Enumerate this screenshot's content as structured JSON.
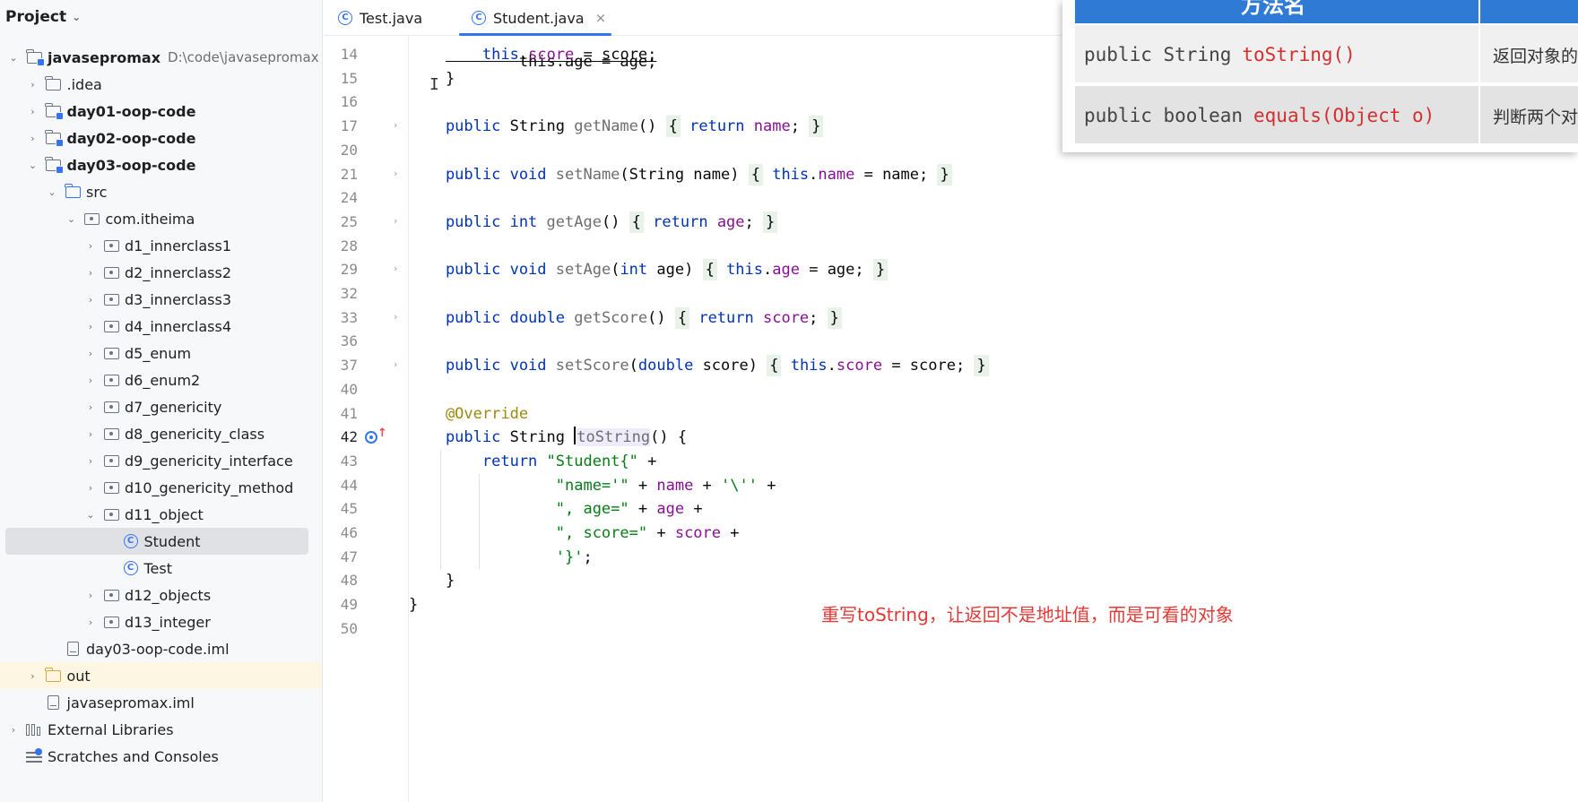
{
  "sidebar": {
    "title": "Project",
    "items": [
      {
        "label": "javasepromax",
        "path": "D:\\code\\javasepromax",
        "indent": 0,
        "arrow": "down",
        "icon": "module",
        "bold": true
      },
      {
        "label": ".idea",
        "indent": 1,
        "arrow": "right",
        "icon": "folder"
      },
      {
        "label": "day01-oop-code",
        "indent": 1,
        "arrow": "right",
        "icon": "module",
        "bold": true
      },
      {
        "label": "day02-oop-code",
        "indent": 1,
        "arrow": "right",
        "icon": "module",
        "bold": true
      },
      {
        "label": "day03-oop-code",
        "indent": 1,
        "arrow": "down",
        "icon": "module",
        "bold": true
      },
      {
        "label": "src",
        "indent": 2,
        "arrow": "down",
        "icon": "src"
      },
      {
        "label": "com.itheima",
        "indent": 3,
        "arrow": "down",
        "icon": "package"
      },
      {
        "label": "d1_innerclass1",
        "indent": 4,
        "arrow": "right",
        "icon": "package"
      },
      {
        "label": "d2_innerclass2",
        "indent": 4,
        "arrow": "right",
        "icon": "package"
      },
      {
        "label": "d3_innerclass3",
        "indent": 4,
        "arrow": "right",
        "icon": "package"
      },
      {
        "label": "d4_innerclass4",
        "indent": 4,
        "arrow": "right",
        "icon": "package"
      },
      {
        "label": "d5_enum",
        "indent": 4,
        "arrow": "right",
        "icon": "package"
      },
      {
        "label": "d6_enum2",
        "indent": 4,
        "arrow": "right",
        "icon": "package"
      },
      {
        "label": "d7_genericity",
        "indent": 4,
        "arrow": "right",
        "icon": "package"
      },
      {
        "label": "d8_genericity_class",
        "indent": 4,
        "arrow": "right",
        "icon": "package"
      },
      {
        "label": "d9_genericity_interface",
        "indent": 4,
        "arrow": "right",
        "icon": "package"
      },
      {
        "label": "d10_genericity_method",
        "indent": 4,
        "arrow": "right",
        "icon": "package"
      },
      {
        "label": "d11_object",
        "indent": 4,
        "arrow": "down",
        "icon": "package"
      },
      {
        "label": "Student",
        "indent": 5,
        "arrow": "",
        "icon": "class",
        "selected": true
      },
      {
        "label": "Test",
        "indent": 5,
        "arrow": "",
        "icon": "class"
      },
      {
        "label": "d12_objects",
        "indent": 4,
        "arrow": "right",
        "icon": "package"
      },
      {
        "label": "d13_integer",
        "indent": 4,
        "arrow": "right",
        "icon": "package"
      },
      {
        "label": "day03-oop-code.iml",
        "indent": 2,
        "arrow": "",
        "icon": "file"
      },
      {
        "label": "out",
        "indent": 1,
        "arrow": "right",
        "icon": "folder-orange",
        "highlight": true
      },
      {
        "label": "javasepromax.iml",
        "indent": 1,
        "arrow": "",
        "icon": "file"
      },
      {
        "label": "External Libraries",
        "indent": 0,
        "arrow": "right",
        "icon": "library"
      },
      {
        "label": "Scratches and Consoles",
        "indent": 0,
        "arrow": "",
        "icon": "scratches"
      }
    ]
  },
  "tabs": [
    {
      "label": "Test.java",
      "active": false
    },
    {
      "label": "Student.java",
      "active": true,
      "close": "×"
    }
  ],
  "editor": {
    "line_numbers": [
      "14",
      "15",
      "16",
      "17",
      "20",
      "21",
      "24",
      "25",
      "28",
      "29",
      "32",
      "33",
      "36",
      "37",
      "40",
      "41",
      "42",
      "43",
      "44",
      "45",
      "46",
      "47",
      "48",
      "49",
      "50"
    ],
    "current_line": "42",
    "lines": [
      {
        "n": "14",
        "segs": [
          [
            "",
            "        "
          ],
          [
            "kw",
            "this"
          ],
          [
            "",
            ".",
            ""
          ],
          [
            "fld",
            "score"
          ],
          [
            "",
            " = score;"
          ]
        ]
      },
      {
        "n": "15",
        "segs": [
          [
            "",
            "    }"
          ]
        ]
      },
      {
        "n": "16",
        "segs": []
      },
      {
        "n": "17",
        "segs": [
          [
            "kw",
            "    public "
          ],
          [
            "",
            "String "
          ],
          [
            "fn",
            "getName"
          ],
          [
            "",
            "() "
          ],
          [
            "brc",
            "{"
          ],
          [
            "kw",
            " return "
          ],
          [
            "fld",
            "name"
          ],
          [
            "",
            "; "
          ],
          [
            "brc",
            "}"
          ]
        ]
      },
      {
        "n": "20",
        "segs": []
      },
      {
        "n": "21",
        "segs": [
          [
            "kw",
            "    public void "
          ],
          [
            "fn",
            "setName"
          ],
          [
            "",
            "(String name) "
          ],
          [
            "brc",
            "{"
          ],
          [
            "kw",
            " this"
          ],
          [
            "",
            "."
          ],
          [
            "fld",
            "name"
          ],
          [
            "",
            " = name; "
          ],
          [
            "brc",
            "}"
          ]
        ]
      },
      {
        "n": "24",
        "segs": []
      },
      {
        "n": "25",
        "segs": [
          [
            "kw",
            "    public int "
          ],
          [
            "fn",
            "getAge"
          ],
          [
            "",
            "() "
          ],
          [
            "brc",
            "{"
          ],
          [
            "kw",
            " return "
          ],
          [
            "fld",
            "age"
          ],
          [
            "",
            "; "
          ],
          [
            "brc",
            "}"
          ]
        ]
      },
      {
        "n": "28",
        "segs": []
      },
      {
        "n": "29",
        "segs": [
          [
            "kw",
            "    public void "
          ],
          [
            "fn",
            "setAge"
          ],
          [
            "",
            "("
          ],
          [
            "kw",
            "int"
          ],
          [
            "",
            " age) "
          ],
          [
            "brc",
            "{"
          ],
          [
            "kw",
            " this"
          ],
          [
            "",
            "."
          ],
          [
            "fld",
            "age"
          ],
          [
            "",
            " = age; "
          ],
          [
            "brc",
            "}"
          ]
        ]
      },
      {
        "n": "32",
        "segs": []
      },
      {
        "n": "33",
        "segs": [
          [
            "kw",
            "    public double "
          ],
          [
            "fn",
            "getScore"
          ],
          [
            "",
            "() "
          ],
          [
            "brc",
            "{"
          ],
          [
            "kw",
            " return "
          ],
          [
            "fld",
            "score"
          ],
          [
            "",
            "; "
          ],
          [
            "brc",
            "}"
          ]
        ]
      },
      {
        "n": "36",
        "segs": []
      },
      {
        "n": "37",
        "segs": [
          [
            "kw",
            "    public void "
          ],
          [
            "fn",
            "setScore"
          ],
          [
            "",
            "("
          ],
          [
            "kw",
            "double"
          ],
          [
            "",
            " score) "
          ],
          [
            "brc",
            "{"
          ],
          [
            "kw",
            " this"
          ],
          [
            "",
            "."
          ],
          [
            "fld",
            "score"
          ],
          [
            "",
            " = score; "
          ],
          [
            "brc",
            "}"
          ]
        ]
      },
      {
        "n": "40",
        "segs": []
      },
      {
        "n": "41",
        "segs": [
          [
            "ann",
            "    @Override"
          ]
        ]
      },
      {
        "n": "42",
        "segs": [
          [
            "kw",
            "    public "
          ],
          [
            "",
            "String "
          ],
          [
            "caret",
            ""
          ],
          [
            "hl",
            "toString"
          ],
          [
            "",
            "() {"
          ]
        ]
      },
      {
        "n": "43",
        "segs": [
          [
            "kw",
            "        return "
          ],
          [
            "str",
            "\"Student{\""
          ],
          [
            "",
            " +"
          ]
        ]
      },
      {
        "n": "44",
        "segs": [
          [
            "str",
            "                \"name='\""
          ],
          [
            "",
            " + "
          ],
          [
            "fld",
            "name"
          ],
          [
            "",
            " + "
          ],
          [
            "str",
            "'\\''"
          ],
          [
            "",
            " +"
          ]
        ]
      },
      {
        "n": "45",
        "segs": [
          [
            "str",
            "                \", age=\""
          ],
          [
            "",
            " + "
          ],
          [
            "fld",
            "age"
          ],
          [
            "",
            " +"
          ]
        ]
      },
      {
        "n": "46",
        "segs": [
          [
            "str",
            "                \", score=\""
          ],
          [
            "",
            " + "
          ],
          [
            "fld",
            "score"
          ],
          [
            "",
            " +"
          ]
        ]
      },
      {
        "n": "47",
        "segs": [
          [
            "str",
            "                '}'"
          ],
          [
            "",
            ";"
          ]
        ]
      },
      {
        "n": "48",
        "segs": [
          [
            "",
            "    }"
          ]
        ]
      },
      {
        "n": "49",
        "segs": [
          [
            "",
            "}"
          ]
        ]
      },
      {
        "n": "50",
        "segs": []
      }
    ],
    "partial_top_line": "        this.age = age;",
    "annotation_note": "重写toString，让返回不是地址值，而是可看的对象"
  },
  "overlay": {
    "header_text": "方法名",
    "rows": [
      {
        "prefix": "public String",
        "method": "toString()",
        "desc": "返回对象的"
      },
      {
        "prefix": "public boolean",
        "method": "equals(Object o)",
        "desc": "判断两个对"
      }
    ]
  },
  "colors": {
    "keyword": "#0033b3",
    "field": "#871094",
    "string": "#067d17",
    "annotation": "#9e880d",
    "accent": "#3574f0",
    "note": "#e53935"
  }
}
